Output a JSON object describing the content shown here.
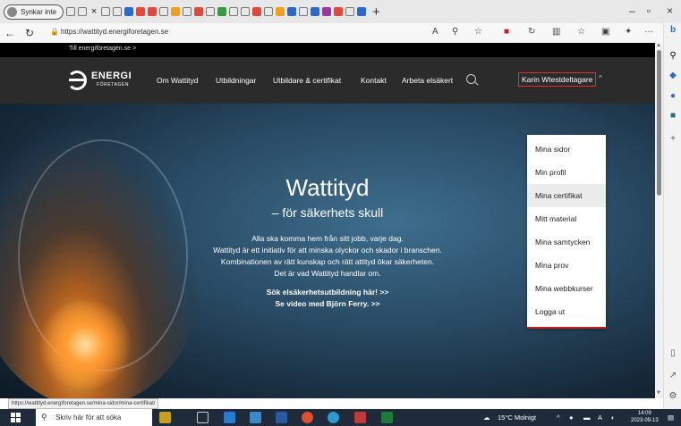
{
  "browser": {
    "profile_label": "Synkar inte",
    "url": "https://wattityd.energiforetagen.se",
    "status_url": "https://wattityd.energiforetagen.se/mina-sidor/mina-certifikat/"
  },
  "site": {
    "top_link": "Till energiföretagen.se >",
    "logo": {
      "line1": "ENERGI",
      "line2": "FÖRETAGEN"
    },
    "nav": [
      "Om Wattityd",
      "Utbildningar",
      "Utbildare & certifikat",
      "Kontakt",
      "Arbeta elsäkert"
    ],
    "user_name": "Karin Wtestdeltagare",
    "user_chevron": "^"
  },
  "hero": {
    "title": "Wattityd",
    "subtitle": "– för säkerhets skull",
    "body": [
      "Alla ska komma hem från sitt jobb, varje dag.",
      "Wattityd är ett initiativ för att minska olyckor och skador i branschen.",
      "Kombinationen av rätt kunskap och rätt attityd ökar säkerheten.",
      "Det är vad Wattityd handlar om."
    ],
    "links": [
      "Sök elsäkerhetsutbildning här! >>",
      "Se video med Björn Ferry. >>"
    ]
  },
  "dropdown": {
    "items": [
      "Mina sidor",
      "Min profil",
      "Mina certifikat",
      "Mitt material",
      "Mina samtycken",
      "Mina prov",
      "Mina webbkurser",
      "Logga ut"
    ],
    "active_index": 2
  },
  "taskbar": {
    "search_placeholder": "Skriv här för att söka",
    "weather": "15°C Molnigt",
    "time": "14:09",
    "date": "2023-09-13"
  },
  "colors": {
    "accent_red": "#e03030",
    "navbar_bg": "#2b2b2b",
    "taskbar_bg": "#1f2b3a"
  }
}
